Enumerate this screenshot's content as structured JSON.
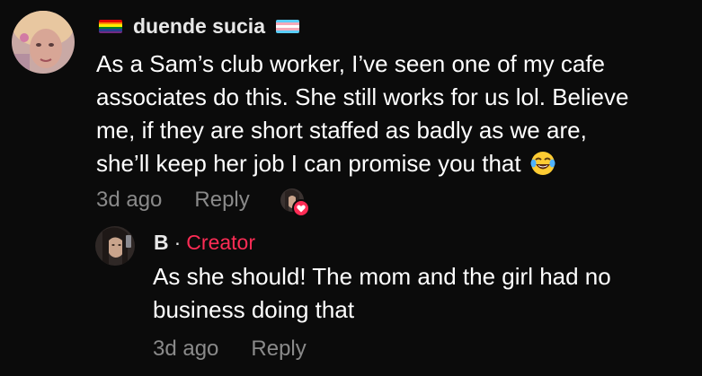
{
  "comment": {
    "username": "duende sucia",
    "flag_left": "rainbow-flag-icon",
    "flag_right": "trans-flag-icon",
    "text_lines": [
      "As a Sam’s club worker, I’ve seen one of my cafe",
      "associates do this. She still works for us lol. Believe",
      "me, if they are short staffed as badly as we are,",
      "she’ll keep her job I can promise you that"
    ],
    "emoji": "laughing-tears-emoji",
    "time": "3d ago",
    "reply_label": "Reply",
    "liked_by_creator_icon": "heart-icon"
  },
  "reply": {
    "username": "B",
    "separator": "·",
    "badge": "Creator",
    "text_lines": [
      "As she should! The mom and the girl had no",
      "business doing that"
    ],
    "time": "3d ago",
    "reply_label": "Reply"
  },
  "colors": {
    "background": "#0b0b0b",
    "accent": "#fe2c55",
    "meta_text": "#8a8a8a"
  }
}
